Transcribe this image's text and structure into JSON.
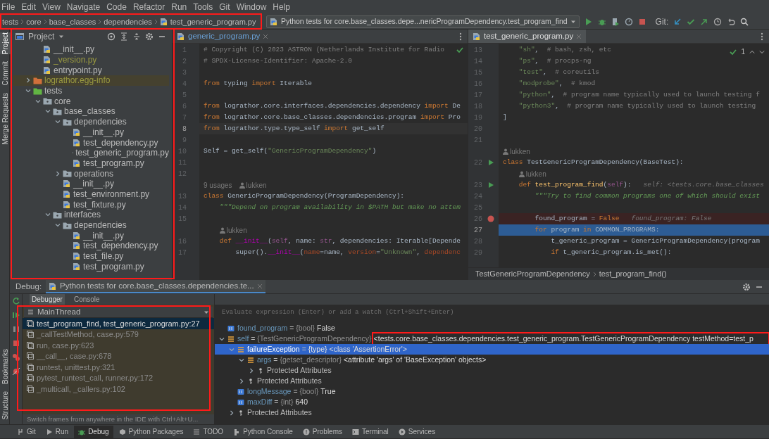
{
  "menu": [
    "File",
    "Edit",
    "View",
    "Navigate",
    "Code",
    "Refactor",
    "Run",
    "Tools",
    "Git",
    "Window",
    "Help"
  ],
  "breadcrumbs": [
    "tests",
    "core",
    "base_classes",
    "dependencies",
    "test_generic_program.py"
  ],
  "run_config": "Python tests for core.base_classes.depe...nericProgramDependency.test_program_find",
  "git_label": "Git:",
  "left_strip": [
    {
      "label": "Project",
      "selected": true
    },
    {
      "label": "Commit",
      "selected": false
    },
    {
      "label": "Merge Requests",
      "selected": false
    }
  ],
  "left_strip_bottom": [
    {
      "label": "Bookmarks",
      "selected": false
    },
    {
      "label": "Structure",
      "selected": false
    }
  ],
  "project": {
    "title": "Project",
    "tree": [
      {
        "children": [
          {
            "label": "__init__.py",
            "kind": "file",
            "ignored": false
          },
          {
            "label": "_version.py",
            "kind": "file",
            "ignored": true
          },
          {
            "label": "entrypoint.py",
            "kind": "file",
            "ignored": false
          }
        ]
      },
      {
        "label": "lograthor.egg-info",
        "kind": "excluded",
        "ignored": true,
        "expanded": false
      },
      {
        "label": "tests",
        "kind": "tests-root",
        "ignored": false,
        "expanded": true,
        "children": [
          {
            "label": "core",
            "kind": "package",
            "ignored": false,
            "expanded": true,
            "children": [
              {
                "label": "base_classes",
                "kind": "package",
                "ignored": false,
                "expanded": true,
                "children": [
                  {
                    "label": "dependencies",
                    "kind": "package",
                    "ignored": false,
                    "expanded": true,
                    "children": [
                      {
                        "label": "__init__.py",
                        "kind": "file",
                        "ignored": false
                      },
                      {
                        "label": "test_dependency.py",
                        "kind": "file",
                        "ignored": false
                      },
                      {
                        "label": "test_generic_program.py",
                        "kind": "file",
                        "ignored": false
                      },
                      {
                        "label": "test_program.py",
                        "kind": "file",
                        "ignored": false
                      }
                    ]
                  },
                  {
                    "label": "operations",
                    "kind": "package",
                    "ignored": false,
                    "expanded": false
                  },
                  {
                    "label": "__init__.py",
                    "kind": "file",
                    "ignored": false
                  },
                  {
                    "label": "test_environment.py",
                    "kind": "file",
                    "ignored": false
                  },
                  {
                    "label": "test_fixture.py",
                    "kind": "file",
                    "ignored": false
                  }
                ]
              },
              {
                "label": "interfaces",
                "kind": "package",
                "ignored": false,
                "expanded": true,
                "children": [
                  {
                    "label": "dependencies",
                    "kind": "package",
                    "ignored": false,
                    "expanded": true,
                    "children": [
                      {
                        "label": "__init__.py",
                        "kind": "file",
                        "ignored": false
                      },
                      {
                        "label": "test_dependency.py",
                        "kind": "file",
                        "ignored": false
                      },
                      {
                        "label": "test_file.py",
                        "kind": "file",
                        "ignored": false
                      },
                      {
                        "label": "test_program.py",
                        "kind": "file",
                        "ignored": false
                      }
                    ]
                  }
                ]
              }
            ]
          }
        ]
      }
    ]
  },
  "editors": [
    {
      "tab": "generic_program.py",
      "selected": false,
      "lines": [
        {
          "kind": "code",
          "number": "1",
          "tokens": [
            {
              "kind": "comment",
              "text": "# Copyright (C) 2023 ASTRON (Netherlands Institute for Radio"
            }
          ]
        },
        {
          "kind": "code",
          "number": "2",
          "tokens": [
            {
              "kind": "comment",
              "text": "# SPDX-License-Identifier: Apache-2.0"
            }
          ]
        },
        {
          "kind": "code",
          "number": "3"
        },
        {
          "kind": "code",
          "number": "4",
          "tokens": [
            {
              "kind": "keyword",
              "text": "from "
            },
            {
              "kind": "plain",
              "text": "typing "
            },
            {
              "kind": "keyword",
              "text": "import "
            },
            {
              "kind": "plain",
              "text": "Iterable"
            }
          ]
        },
        {
          "kind": "code",
          "number": "5"
        },
        {
          "kind": "code",
          "number": "6",
          "tokens": [
            {
              "kind": "keyword",
              "text": "from "
            },
            {
              "kind": "plain",
              "text": "lograthor.core.interfaces.dependencies.dependency "
            },
            {
              "kind": "keyword",
              "text": "import "
            },
            {
              "kind": "plain",
              "text": "De"
            }
          ]
        },
        {
          "kind": "code",
          "number": "7",
          "tokens": [
            {
              "kind": "keyword",
              "text": "from "
            },
            {
              "kind": "plain",
              "text": "lograthor.core.base_classes.dependencies.program "
            },
            {
              "kind": "keyword",
              "text": "import "
            },
            {
              "kind": "plain",
              "text": "Pro"
            }
          ]
        },
        {
          "kind": "caret",
          "number": "8",
          "tokens": [
            {
              "kind": "keyword",
              "text": "from "
            },
            {
              "kind": "plain",
              "text": "lograthor.type.type_self "
            },
            {
              "kind": "keyword",
              "text": "import "
            },
            {
              "kind": "plain",
              "text": "get_self"
            }
          ]
        },
        {
          "kind": "code",
          "number": "9"
        },
        {
          "kind": "code",
          "number": "10",
          "tokens": [
            {
              "kind": "plain",
              "text": "Self = get_self("
            },
            {
              "kind": "string",
              "text": "\"GenericProgramDependency\""
            },
            {
              "kind": "plain",
              "text": ")"
            }
          ]
        },
        {
          "kind": "code",
          "number": "11"
        },
        {
          "kind": "code",
          "number": "12"
        },
        {
          "kind": "hint",
          "usages": "9 usages",
          "author": "lukken"
        },
        {
          "kind": "code",
          "number": "13",
          "tokens": [
            {
              "kind": "keyword",
              "text": "class "
            },
            {
              "kind": "plain",
              "text": "GenericProgramDependency(ProgramDependency):"
            }
          ]
        },
        {
          "kind": "code",
          "number": "14",
          "tokens": [
            {
              "kind": "docstring",
              "text": "    \"\"\"Depend on program availability in $PATH but make no attem"
            }
          ]
        },
        {
          "kind": "code",
          "number": "15"
        },
        {
          "kind": "hint",
          "author": "lukken"
        },
        {
          "kind": "code",
          "number": "16",
          "tokens": [
            {
              "kind": "keyword",
              "text": "    def "
            },
            {
              "kind": "magic",
              "text": "__init__"
            },
            {
              "kind": "plain",
              "text": "("
            },
            {
              "kind": "self",
              "text": "self"
            },
            {
              "kind": "plain",
              "text": ", name: "
            },
            {
              "kind": "self",
              "text": "str"
            },
            {
              "kind": "plain",
              "text": ", dependencies: Iterable[Depende"
            }
          ]
        },
        {
          "kind": "code",
          "number": "17",
          "tokens": [
            {
              "kind": "plain",
              "text": "        super()."
            },
            {
              "kind": "magic",
              "text": "__init__"
            },
            {
              "kind": "plain",
              "text": "("
            },
            {
              "kind": "argument",
              "text": "name"
            },
            {
              "kind": "plain",
              "text": "=name, "
            },
            {
              "kind": "argument",
              "text": "version"
            },
            {
              "kind": "plain",
              "text": "="
            },
            {
              "kind": "string",
              "text": "\"Unknown\""
            },
            {
              "kind": "plain",
              "text": ", "
            },
            {
              "kind": "argument",
              "text": "dependenc"
            }
          ]
        }
      ]
    },
    {
      "tab": "test_generic_program.py",
      "selected": true,
      "inspection": "1",
      "lines": [
        {
          "kind": "code",
          "number": "13",
          "tokens": [
            {
              "kind": "string",
              "text": "    \"sh\""
            },
            {
              "kind": "plain",
              "text": ",  "
            },
            {
              "kind": "comment",
              "text": "# bash, zsh, etc"
            }
          ]
        },
        {
          "kind": "code",
          "number": "14",
          "tokens": [
            {
              "kind": "string",
              "text": "    \"ps\""
            },
            {
              "kind": "plain",
              "text": ",  "
            },
            {
              "kind": "comment",
              "text": "# procps-ng"
            }
          ]
        },
        {
          "kind": "code",
          "number": "15",
          "tokens": [
            {
              "kind": "string",
              "text": "    \"test\""
            },
            {
              "kind": "plain",
              "text": ",  "
            },
            {
              "kind": "comment",
              "text": "# coreutils"
            }
          ]
        },
        {
          "kind": "code",
          "number": "16",
          "tokens": [
            {
              "kind": "string",
              "text": "    \"modprobe\""
            },
            {
              "kind": "plain",
              "text": ",  "
            },
            {
              "kind": "comment",
              "text": "# kmod"
            }
          ]
        },
        {
          "kind": "code",
          "number": "17",
          "tokens": [
            {
              "kind": "string",
              "text": "    \"python\""
            },
            {
              "kind": "plain",
              "text": ",  "
            },
            {
              "kind": "comment",
              "text": "# program name typically used to launch testing f"
            }
          ]
        },
        {
          "kind": "code",
          "number": "18",
          "tokens": [
            {
              "kind": "string",
              "text": "    \"python3\""
            },
            {
              "kind": "plain",
              "text": ",  "
            },
            {
              "kind": "comment",
              "text": "# program name typically used to launch testing"
            }
          ]
        },
        {
          "kind": "code",
          "number": "19",
          "tokens": [
            {
              "kind": "plain",
              "text": "]"
            }
          ]
        },
        {
          "kind": "code",
          "number": "20"
        },
        {
          "kind": "code",
          "number": "21"
        },
        {
          "kind": "hint",
          "author": "lukken"
        },
        {
          "kind": "runnable",
          "number": "22",
          "tokens": [
            {
              "kind": "keyword",
              "text": "class "
            },
            {
              "kind": "plain",
              "text": "TestGenericProgramDependency(BaseTest):"
            }
          ]
        },
        {
          "kind": "hint",
          "author": "lukken"
        },
        {
          "kind": "runnable",
          "number": "23",
          "tokens": [
            {
              "kind": "keyword",
              "text": "    def "
            },
            {
              "kind": "function",
              "text": "test_program_find"
            },
            {
              "kind": "plain",
              "text": "("
            },
            {
              "kind": "self",
              "text": "self"
            },
            {
              "kind": "plain",
              "text": "):   "
            },
            {
              "kind": "hint",
              "text": "self: <tests.core.base_classes"
            }
          ]
        },
        {
          "kind": "code",
          "number": "24",
          "tokens": [
            {
              "kind": "docstring",
              "text": "        \"\"\"Try to find common programs one of which should exist"
            }
          ]
        },
        {
          "kind": "code",
          "number": "25"
        },
        {
          "kind": "breakpoint",
          "number": "26",
          "tokens": [
            {
              "kind": "plain",
              "text": "        found_program = "
            },
            {
              "kind": "keyword",
              "text": "False   "
            },
            {
              "kind": "hint",
              "text": "found_program: False"
            }
          ]
        },
        {
          "kind": "execution",
          "number": "27",
          "tokens": [
            {
              "kind": "keyword",
              "text": "        for "
            },
            {
              "kind": "plain",
              "text": "program "
            },
            {
              "kind": "keyword",
              "text": "in "
            },
            {
              "kind": "plain",
              "text": "COMMON_PROGRAMS:"
            }
          ]
        },
        {
          "kind": "code",
          "number": "28",
          "tokens": [
            {
              "kind": "plain",
              "text": "            t_generic_program = GenericProgramDependency(program"
            }
          ]
        },
        {
          "kind": "code",
          "number": "29",
          "tokens": [
            {
              "kind": "keyword",
              "text": "            if "
            },
            {
              "kind": "plain",
              "text": "t_generic_program.is_met():"
            }
          ]
        }
      ]
    }
  ],
  "editor_breadcrumb": [
    "TestGenericProgramDependency",
    "test_program_find()"
  ],
  "debug": {
    "label": "Debug:",
    "session_tab": "Python tests for core.base_classes.dependencies.te...",
    "tabs": [
      {
        "label": "Debugger",
        "selected": true
      },
      {
        "label": "Console",
        "selected": false
      }
    ],
    "thread": "MainThread",
    "frames": [
      {
        "text": "test_program_find, test_generic_program.py:27",
        "selected": true,
        "dimmed": false
      },
      {
        "text": "_callTestMethod, case.py:579",
        "selected": false,
        "dimmed": true
      },
      {
        "text": "run, case.py:623",
        "selected": false,
        "dimmed": true
      },
      {
        "text": "__call__, case.py:678",
        "selected": false,
        "dimmed": true
      },
      {
        "text": "runtest, unittest.py:321",
        "selected": false,
        "dimmed": true
      },
      {
        "text": "pytest_runtest_call, runner.py:172",
        "selected": false,
        "dimmed": true
      },
      {
        "text": "_multicall, _callers.py:102",
        "selected": false,
        "dimmed": true
      }
    ],
    "frames_hint": "Switch frames from anywhere in the IDE with Ctrl+Alt+U...",
    "evaluate_placeholder": "Evaluate expression (Enter) or add a watch (Ctrl+Shift+Enter)",
    "variables": [
      {
        "kind": "primitive",
        "name": "found_program",
        "separator": "=",
        "type": "{bool}",
        "value": "False",
        "selected": false
      },
      {
        "kind": "object",
        "name": "self",
        "separator": "=",
        "type": "{TestGenericProgramDependency}",
        "value": "<tests.core.base_classes.dependencies.test_generic_program.TestGenericProgramDependency testMethod=test_p",
        "selected": false,
        "expanded": true,
        "children": [
          {
            "kind": "object",
            "name": "failureException",
            "separator": "=",
            "type": "{type}",
            "value": "<class 'AssertionError'>",
            "selected": true,
            "expanded": true,
            "children": [
              {
                "kind": "object",
                "name": "args",
                "separator": "=",
                "type": "{getset_descriptor}",
                "value": "<attribute 'args' of 'BaseException' objects>",
                "selected": false,
                "expanded": true,
                "children": [
                  {
                    "kind": "group",
                    "name": "Protected Attributes",
                    "selected": false,
                    "expanded": false
                  }
                ]
              },
              {
                "kind": "group",
                "name": "Protected Attributes",
                "selected": false,
                "expanded": false
              }
            ]
          },
          {
            "kind": "primitive",
            "name": "longMessage",
            "separator": "=",
            "type": "{bool}",
            "value": "True",
            "selected": false
          },
          {
            "kind": "primitive",
            "name": "maxDiff",
            "separator": "=",
            "type": "{int}",
            "value": "640",
            "selected": false
          },
          {
            "kind": "group",
            "name": "Protected Attributes",
            "selected": false,
            "expanded": false
          }
        ]
      }
    ]
  },
  "tool_tabs": [
    {
      "label": "Git",
      "kind": "git",
      "selected": false
    },
    {
      "label": "Run",
      "kind": "run",
      "selected": false
    },
    {
      "label": "Debug",
      "kind": "debug",
      "selected": true
    },
    {
      "label": "Python Packages",
      "kind": "packages",
      "selected": false
    },
    {
      "label": "TODO",
      "kind": "list",
      "selected": false
    },
    {
      "label": "Python Console",
      "kind": "console",
      "selected": false
    },
    {
      "label": "Problems",
      "kind": "problems",
      "selected": false
    },
    {
      "label": "Terminal",
      "kind": "terminal",
      "selected": false
    },
    {
      "label": "Services",
      "kind": "services",
      "selected": false
    }
  ]
}
